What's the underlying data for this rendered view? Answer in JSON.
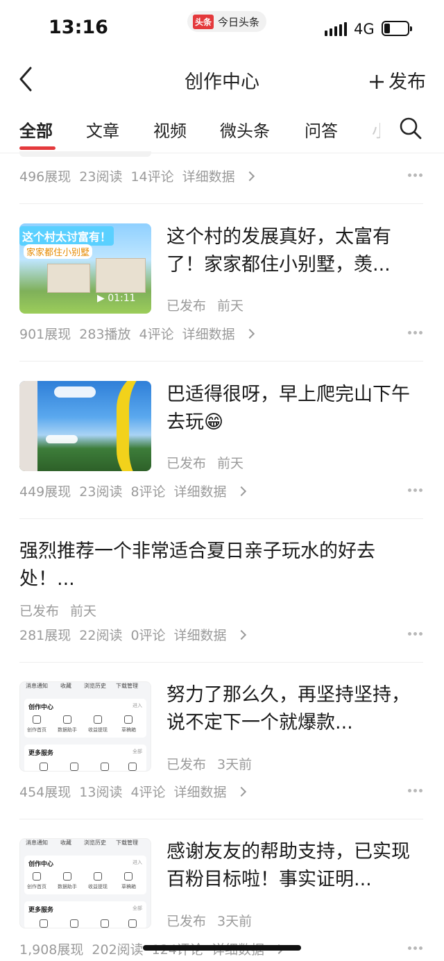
{
  "status_bar": {
    "time": "13:16",
    "app_logo": "头条",
    "app_name": "今日头条",
    "network": "4G"
  },
  "header": {
    "title": "创作中心",
    "publish_label": "发布"
  },
  "tabs": [
    {
      "label": "全部",
      "active": true
    },
    {
      "label": "文章"
    },
    {
      "label": "视频"
    },
    {
      "label": "微头条"
    },
    {
      "label": "问答"
    },
    {
      "label": "小"
    }
  ],
  "detail_label": "详细数据",
  "items": [
    {
      "stats": [
        "496展现",
        "23阅读",
        "14评论"
      ]
    },
    {
      "title": "这个村的发展真好，太富有了！家家都住小别墅，羡...",
      "status": "已发布",
      "time": "前天",
      "stats": [
        "901展现",
        "283播放",
        "4评论"
      ],
      "thumb_banner": "这个村太讨富有！",
      "thumb_sub": "家家都住小别墅",
      "duration": "01:11"
    },
    {
      "title": "巴适得很呀，早上爬完山下午去玩😁",
      "status": "已发布",
      "time": "前天",
      "stats": [
        "449展现",
        "23阅读",
        "8评论"
      ]
    },
    {
      "title": "强烈推荐一个非常适合夏日亲子玩水的好去处！...",
      "status": "已发布",
      "time": "前天",
      "stats": [
        "281展现",
        "22阅读",
        "0评论"
      ]
    },
    {
      "title": "努力了那么久，再坚持坚持，说不定下一个就爆款...",
      "status": "已发布",
      "time": "3天前",
      "stats": [
        "454展现",
        "13阅读",
        "4评论"
      ]
    },
    {
      "title": "感谢友友的帮助支持，已实现百粉目标啦！事实证明...",
      "status": "已发布",
      "time": "3天前",
      "stats": [
        "1,908展现",
        "202阅读",
        "124评论"
      ]
    }
  ],
  "thumb_screen": {
    "top_row": [
      "消息通知",
      "收藏",
      "浏览历史",
      "下载管理"
    ],
    "section1": "创作中心",
    "enter": "进入",
    "tools": [
      "创作首页",
      "数据助手",
      "收益提现",
      "草稿箱"
    ],
    "section2": "更多服务",
    "all": "全部"
  }
}
